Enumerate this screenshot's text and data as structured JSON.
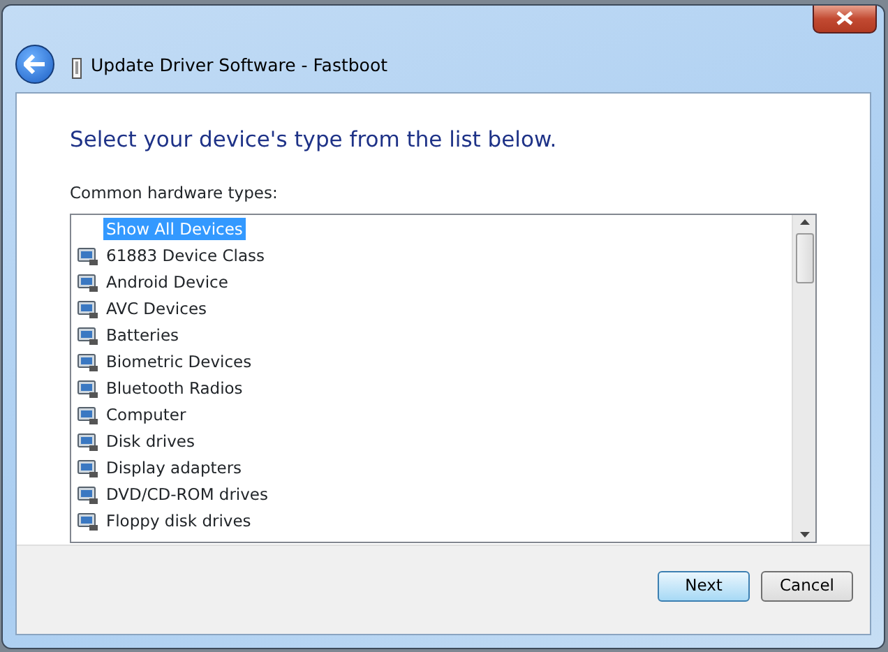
{
  "window": {
    "title": "Update Driver Software - Fastboot"
  },
  "heading": "Select your device's type from the list below.",
  "list_label": "Common hardware types:",
  "items": [
    {
      "label": "Show All Devices",
      "selected": true
    },
    {
      "label": "61883 Device Class",
      "selected": false
    },
    {
      "label": "Android Device",
      "selected": false
    },
    {
      "label": "AVC Devices",
      "selected": false
    },
    {
      "label": "Batteries",
      "selected": false
    },
    {
      "label": "Biometric Devices",
      "selected": false
    },
    {
      "label": "Bluetooth Radios",
      "selected": false
    },
    {
      "label": "Computer",
      "selected": false
    },
    {
      "label": "Disk drives",
      "selected": false
    },
    {
      "label": "Display adapters",
      "selected": false
    },
    {
      "label": "DVD/CD-ROM drives",
      "selected": false
    },
    {
      "label": "Floppy disk drives",
      "selected": false
    }
  ],
  "buttons": [
    {
      "label": "Next",
      "kind": "default"
    },
    {
      "label": "Cancel",
      "kind": "normal"
    }
  ]
}
